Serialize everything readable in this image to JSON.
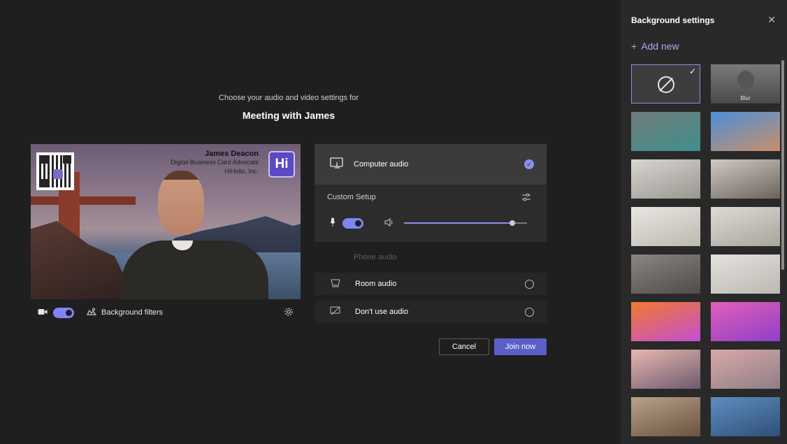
{
  "header": {
    "subtitle": "Choose your audio and video settings for",
    "meeting_title": "Meeting with James"
  },
  "video": {
    "card_name": "James Deacon",
    "card_role": "Digital Business Card Advocate",
    "card_company": "HiHello, Inc.",
    "logo_text": "Hi",
    "camera_on": true,
    "background_filters_label": "Background filters"
  },
  "audio": {
    "computer_audio_label": "Computer audio",
    "custom_setup_label": "Custom Setup",
    "mic_on": true,
    "speaker_volume": 0.88,
    "phone_audio_label": "Phone audio",
    "room_audio_label": "Room audio",
    "no_audio_label": "Don't use audio"
  },
  "actions": {
    "cancel_label": "Cancel",
    "join_label": "Join now"
  },
  "background_panel": {
    "title": "Background settings",
    "add_new_label": "Add new",
    "blur_label": "Blur",
    "tiles": [
      {
        "name": "none",
        "colors": [
          "#3d3d3d",
          "#3d3d3d"
        ]
      },
      {
        "name": "blur",
        "colors": [
          "#7a7a7a",
          "#4a4a4a"
        ]
      },
      {
        "name": "office-teal",
        "colors": [
          "#6f7c7a",
          "#3f8f8c"
        ]
      },
      {
        "name": "beach-blue",
        "colors": [
          "#4b8fd8",
          "#c98f6a"
        ]
      },
      {
        "name": "room-white",
        "colors": [
          "#d8d6d2",
          "#9a9690"
        ]
      },
      {
        "name": "room-mirror",
        "colors": [
          "#cfcac2",
          "#6b645c"
        ]
      },
      {
        "name": "hall-white",
        "colors": [
          "#e9e7e3",
          "#bdb8b0"
        ]
      },
      {
        "name": "bedroom-white",
        "colors": [
          "#dedbd6",
          "#a9a49c"
        ]
      },
      {
        "name": "office-windows",
        "colors": [
          "#8a8684",
          "#4f4b48"
        ]
      },
      {
        "name": "room-plain",
        "colors": [
          "#e4e2de",
          "#bcb8b2"
        ]
      },
      {
        "name": "balloons",
        "colors": [
          "#f27a2c",
          "#c24fd6"
        ]
      },
      {
        "name": "spheres-pink",
        "colors": [
          "#e25fb8",
          "#8f3fc9"
        ]
      },
      {
        "name": "bridge-sunset",
        "colors": [
          "#e8b8b0",
          "#6e5a6e"
        ]
      },
      {
        "name": "rocks-pastel",
        "colors": [
          "#d9a8a8",
          "#8e7f86"
        ]
      },
      {
        "name": "classroom",
        "colors": [
          "#b9a38a",
          "#6a5240"
        ]
      },
      {
        "name": "studio-blue",
        "colors": [
          "#5d8fc0",
          "#2f4f78"
        ]
      }
    ]
  }
}
